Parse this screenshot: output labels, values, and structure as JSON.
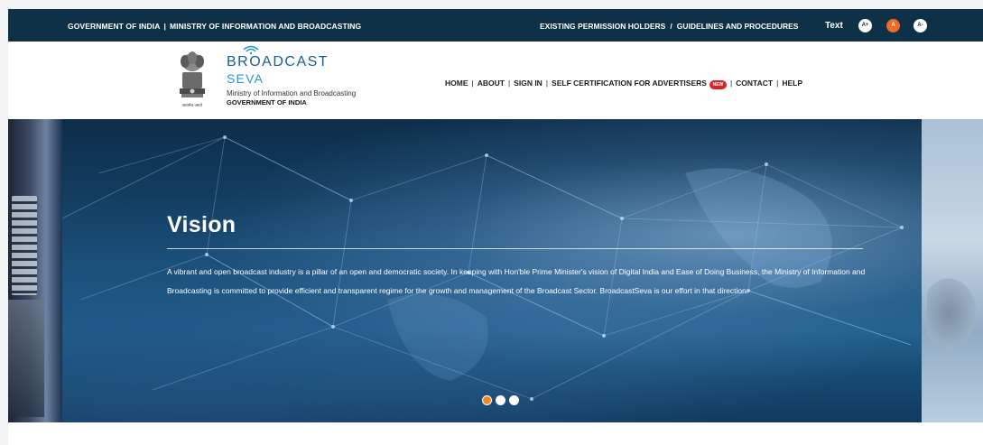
{
  "topbar": {
    "gov_label": "GOVERNMENT OF INDIA",
    "separator": "|",
    "ministry_label": "MINISTRY OF INFORMATION AND BROADCASTING",
    "link_existing": "EXISTING PERMISSION HOLDERS",
    "slash": "/",
    "link_guidelines": "GUIDELINES AND PROCEDURES",
    "text_label": "Text",
    "font_increase": "A+",
    "font_normal": "A",
    "font_decrease": "A-"
  },
  "header": {
    "brand_line1": "BROADCAST",
    "brand_line2": "SEVA",
    "ministry": "Ministry of Information and Broadcasting",
    "government": "GOVERNMENT OF INDIA",
    "emblem_caption": "सत्यमेव जयते"
  },
  "nav": {
    "separator": "|",
    "items": [
      {
        "label": "HOME"
      },
      {
        "label": "ABOUT"
      },
      {
        "label": "SIGN IN"
      },
      {
        "label": "SELF CERTIFICATION FOR ADVERTISERS"
      },
      {
        "label": "CONTACT"
      },
      {
        "label": "HELP"
      }
    ],
    "new_badge": "NEW"
  },
  "hero": {
    "title": "Vision",
    "text": "A vibrant and open broadcast industry is a pillar of an open and democratic society. In keeping with Hon'ble Prime Minister's vision of Digital India and Ease of Doing Business, the Ministry of Information and Broadcasting is committed to provide efficient and transparent regime for the growth and management of the Broadcast Sector. BroadcastSeva is our effort in that direction.",
    "slides": 3,
    "active_slide": 1
  },
  "colors": {
    "topbar": "#0f3148",
    "brand_dark": "#155f96",
    "brand_light": "#1c9ad6",
    "active_font": "#f06a24",
    "active_dot": "#f08a24",
    "new_badge": "#d8232a"
  }
}
